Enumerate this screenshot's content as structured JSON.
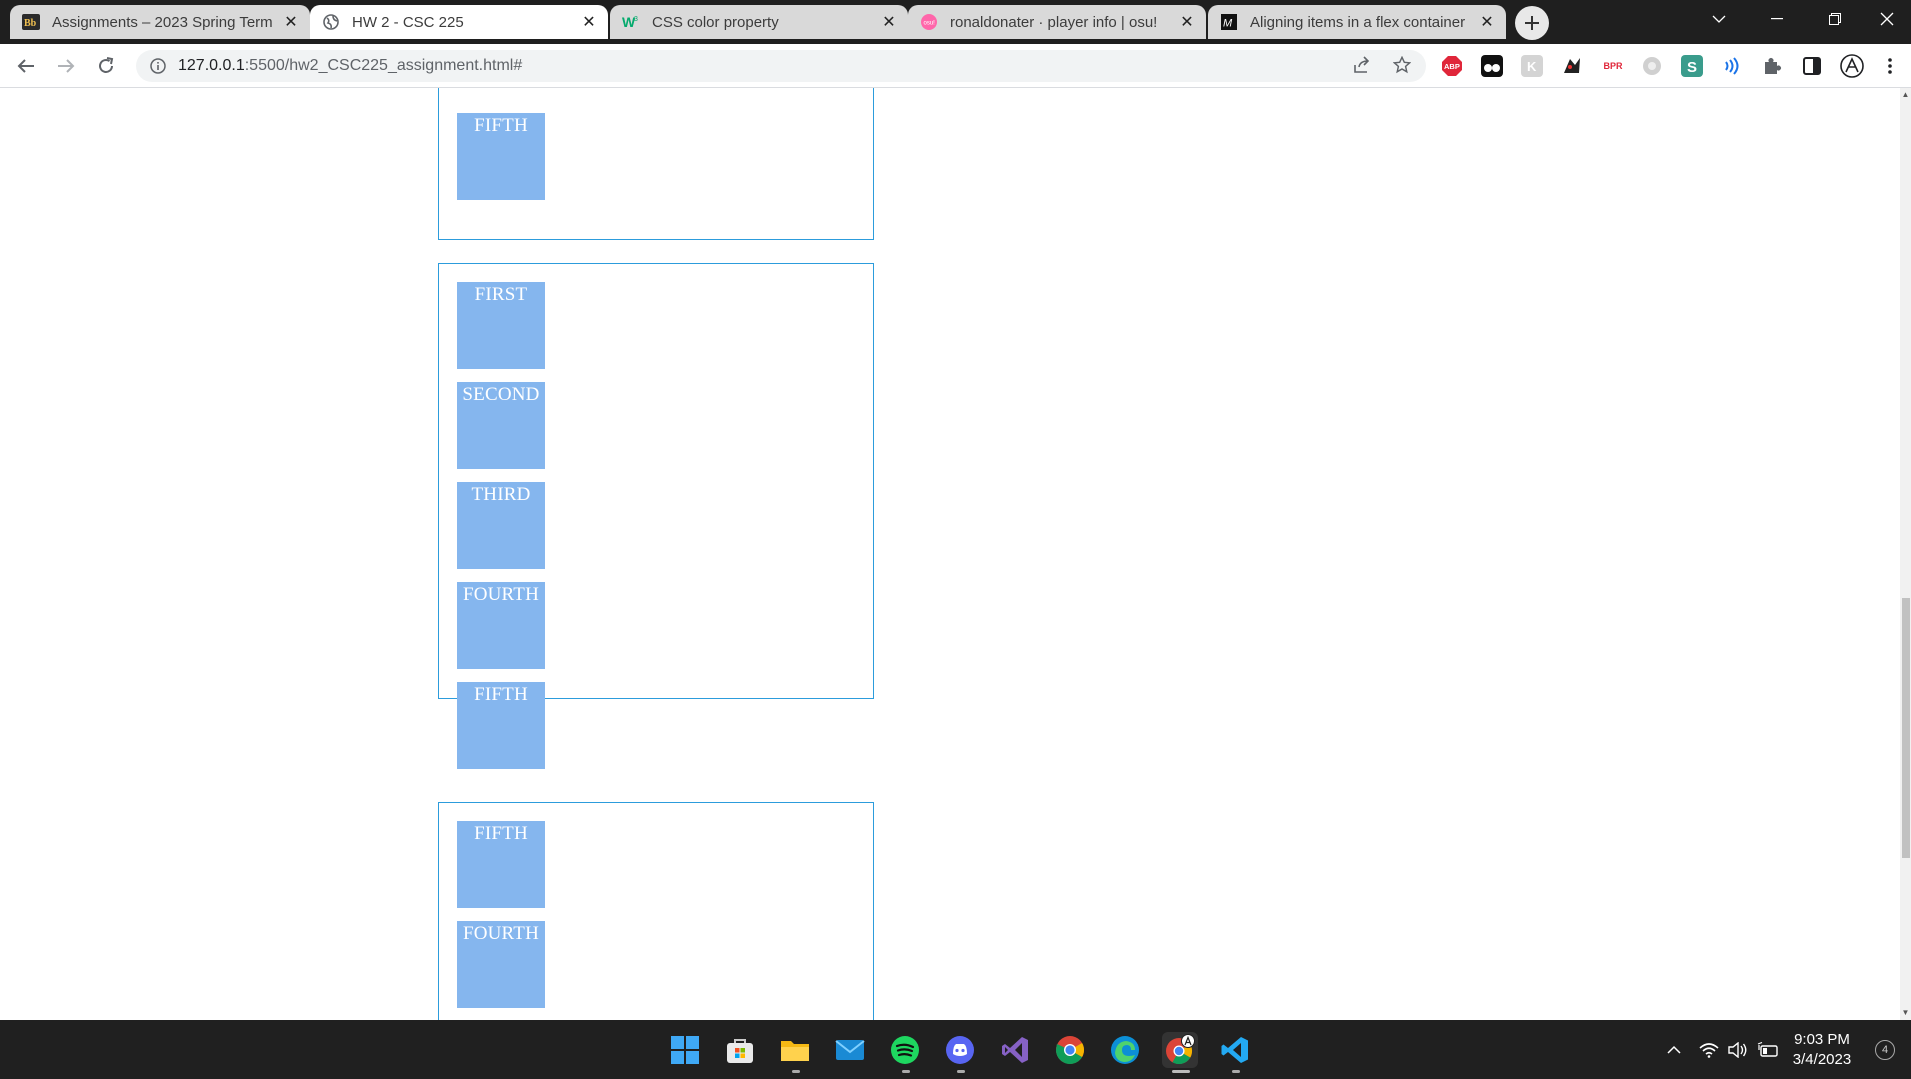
{
  "browser": {
    "tabs": [
      {
        "label": "Assignments – 2023 Spring Term",
        "favicon": "bb-icon",
        "active": false
      },
      {
        "label": "HW 2 - CSC 225",
        "favicon": "globe-icon",
        "active": true
      },
      {
        "label": "CSS color property",
        "favicon": "w3-icon",
        "active": false
      },
      {
        "label": "ronaldonater · player info | osu!",
        "favicon": "osu-icon",
        "active": false
      },
      {
        "label": "Aligning items in a flex container",
        "favicon": "mdn-icon",
        "active": false
      }
    ],
    "address": {
      "host": "127.0.0.1",
      "path": ":5500/hw2_CSC225_assignment.html#"
    },
    "extensions": {
      "abp": "ABP",
      "bpr": "BPR"
    }
  },
  "page": {
    "containers": [
      {
        "items": [
          "FIFTH"
        ]
      },
      {
        "items": [
          "FIRST",
          "SECOND",
          "THIRD",
          "FOURTH",
          "FIFTH"
        ]
      },
      {
        "items": [
          "FIFTH",
          "FOURTH"
        ]
      }
    ],
    "colors": {
      "box": "#85b6ee",
      "border": "#2c9cdc"
    }
  },
  "taskbar": {
    "time": "9:03 PM",
    "date": "3/4/2023",
    "notification_count": "4"
  }
}
